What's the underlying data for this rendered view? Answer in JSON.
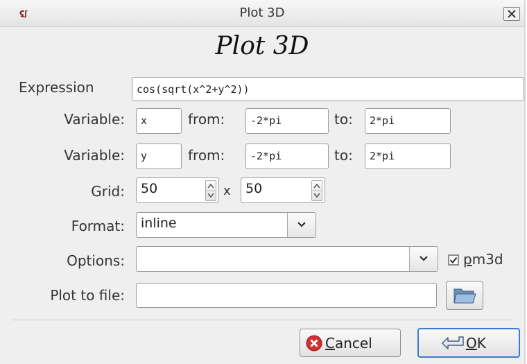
{
  "window": {
    "icon_text": "ʢꭍ",
    "title": "Plot 3D",
    "close_icon": "close-x-icon"
  },
  "heading": "Plot 3D",
  "expression": {
    "label": "Expression",
    "value": "cos(sqrt(x^2+y^2))"
  },
  "variables": [
    {
      "label": "Variable:",
      "name": "x",
      "from_label": "from:",
      "from": "-2*pi",
      "to_label": "to:",
      "to": "2*pi"
    },
    {
      "label": "Variable:",
      "name": "y",
      "from_label": "from:",
      "from": "-2*pi",
      "to_label": "to:",
      "to": "2*pi"
    }
  ],
  "grid": {
    "label": "Grid:",
    "x_value": "50",
    "separator": "x",
    "y_value": "50"
  },
  "format": {
    "label": "Format:",
    "value": "inline"
  },
  "options": {
    "label": "Options:",
    "value": "",
    "pm3d_label_prefix": "",
    "pm3d_label_underlined": "p",
    "pm3d_label_rest": "m3d",
    "pm3d_checked": true
  },
  "plot_to_file": {
    "label": "Plot to file:",
    "value": "",
    "browse_icon": "folder-open-icon"
  },
  "buttons": {
    "cancel_underlined": "C",
    "cancel_rest": "ancel",
    "ok_underlined": "O",
    "ok_rest": "K"
  },
  "colors": {
    "accent_focus": "#3a7bd5",
    "cancel_icon": "#d32f2f"
  }
}
